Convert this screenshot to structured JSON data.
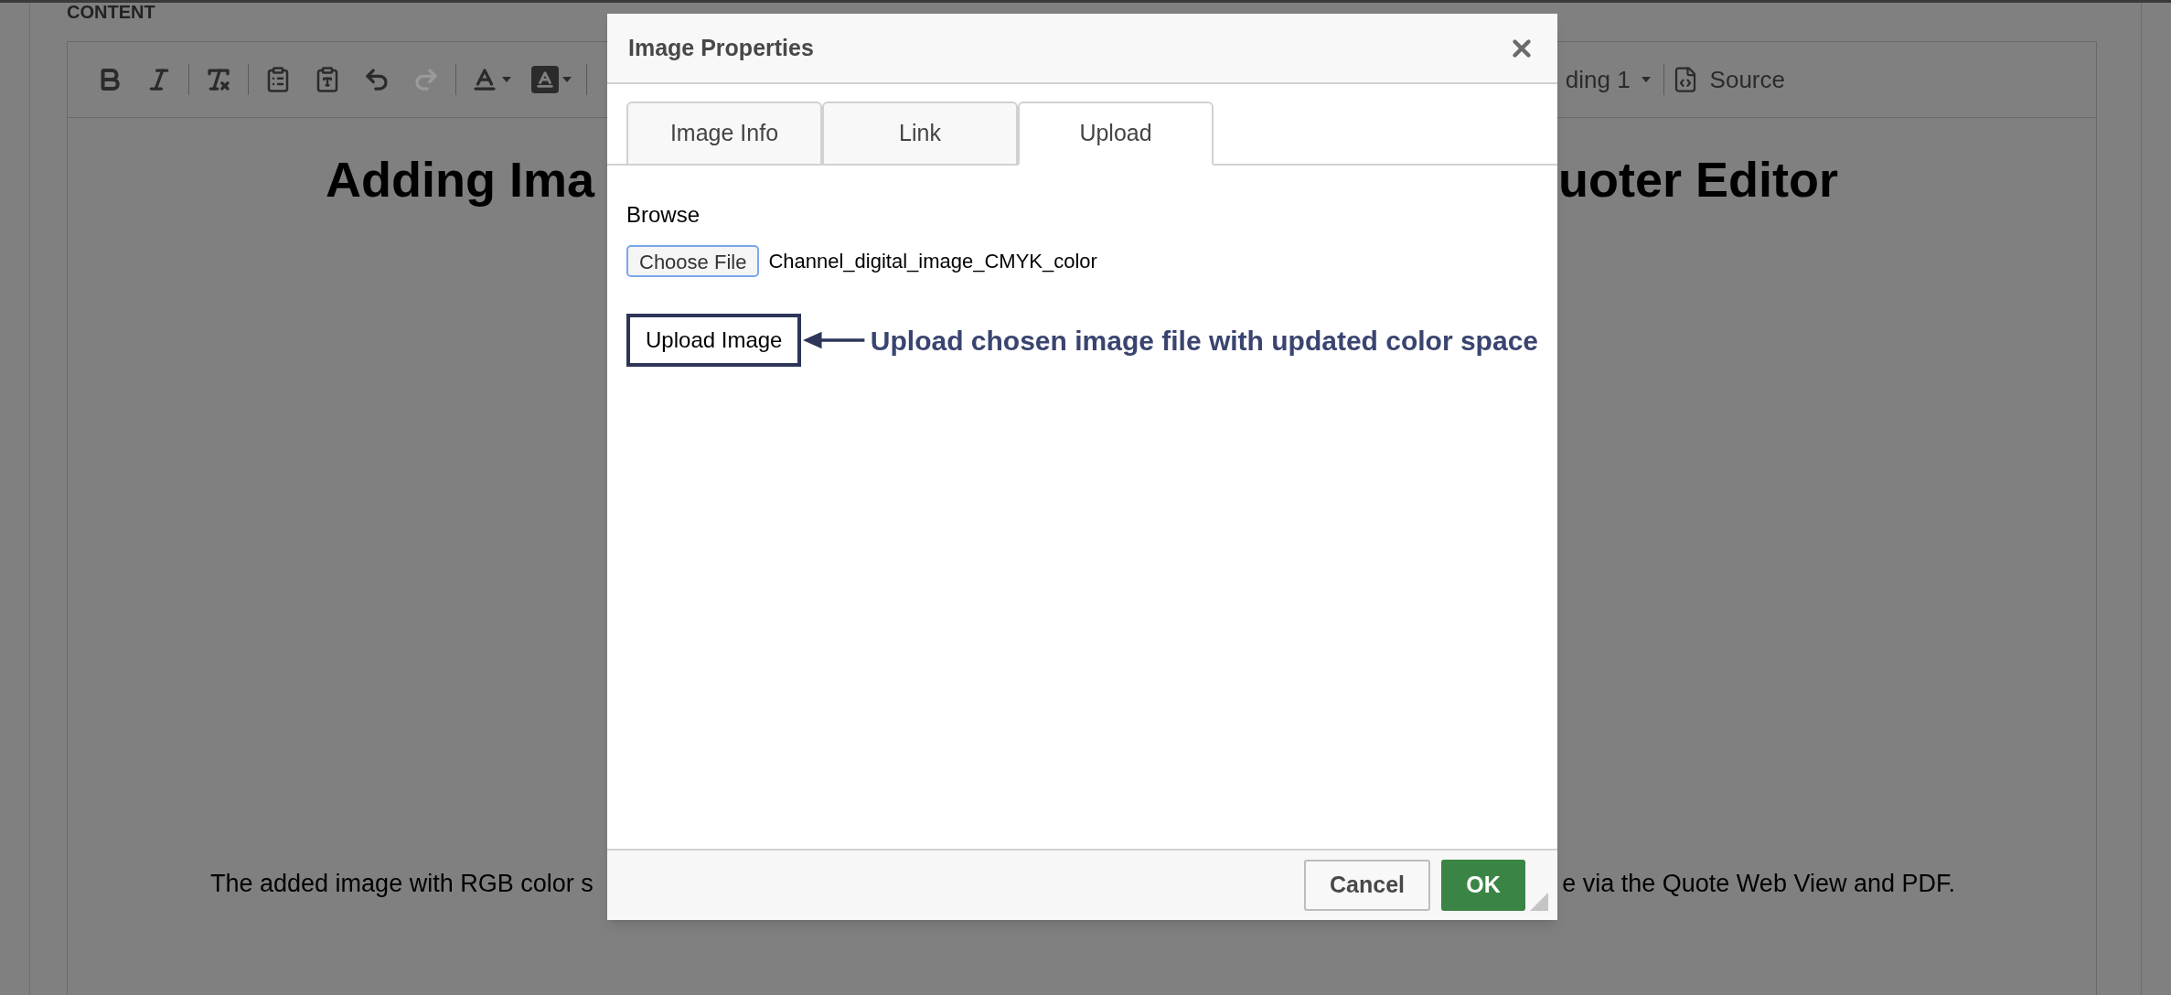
{
  "editor": {
    "section_label": "CONTENT",
    "tools": [
      {
        "kind": "bold",
        "disabled": false
      },
      {
        "kind": "italic",
        "disabled": false
      },
      {
        "kind": "separator"
      },
      {
        "kind": "clear_format",
        "disabled": false
      },
      {
        "kind": "separator"
      },
      {
        "kind": "paste_word",
        "disabled": false
      },
      {
        "kind": "paste_text",
        "disabled": false
      },
      {
        "kind": "undo",
        "disabled": false
      },
      {
        "kind": "redo",
        "disabled": true
      },
      {
        "kind": "separator"
      },
      {
        "kind": "text_color",
        "disabled": false
      },
      {
        "kind": "background_color",
        "disabled": false
      },
      {
        "kind": "separator"
      }
    ],
    "format_dropdown": "ding 1",
    "source_button": "Source",
    "heading_left": "Adding Ima",
    "heading_right": "uoter Editor",
    "paragraph_left": "The added image with RGB color s",
    "paragraph_right": "e via the Quote Web View and PDF."
  },
  "dialog": {
    "title": "Image Properties",
    "tabs": [
      {
        "label": "Image Info",
        "selected": false
      },
      {
        "label": "Link",
        "selected": false
      },
      {
        "label": "Upload",
        "selected": true
      }
    ],
    "browse_label": "Browse",
    "choose_file": "Choose File",
    "file_name": "Channel_digital_image_CMYK_color",
    "upload_button": "Upload Image",
    "annotation": "Upload chosen image file with updated color space",
    "cancel": "Cancel",
    "ok": "OK"
  }
}
